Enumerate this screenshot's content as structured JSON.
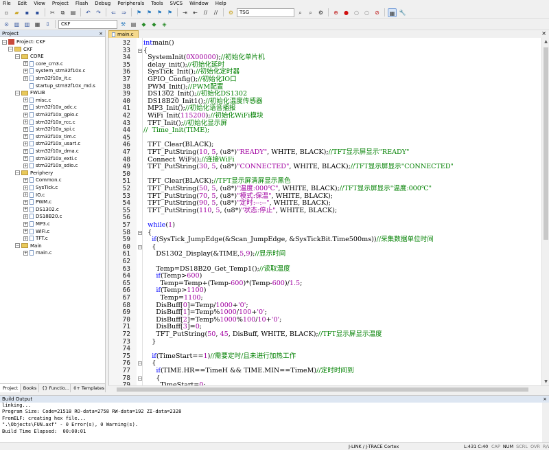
{
  "menu": [
    "File",
    "Edit",
    "View",
    "Project",
    "Flash",
    "Debug",
    "Peripherals",
    "Tools",
    "SVCS",
    "Window",
    "Help"
  ],
  "toolbar": {
    "find_combo": "TSG",
    "target_combo": "CKF"
  },
  "project_panel": {
    "title": "Project",
    "close": "×",
    "tree": [
      {
        "label": "Project: CKF",
        "type": "project",
        "level": 0,
        "pm": "-"
      },
      {
        "label": "CKF",
        "type": "folder",
        "level": 1,
        "pm": "-"
      },
      {
        "label": "CORE",
        "type": "folder",
        "level": 2,
        "pm": "-"
      },
      {
        "label": "core_cm3.c",
        "type": "file",
        "level": 3,
        "pm": "+"
      },
      {
        "label": "system_stm32f10x.c",
        "type": "file",
        "level": 3,
        "pm": "+"
      },
      {
        "label": "stm32f10x_it.c",
        "type": "file",
        "level": 3,
        "pm": "+"
      },
      {
        "label": "startup_stm32f10x_md.s",
        "type": "file",
        "level": 3,
        "pm": ""
      },
      {
        "label": "FWLIB",
        "type": "folder",
        "level": 2,
        "pm": "-"
      },
      {
        "label": "misc.c",
        "type": "file",
        "level": 3,
        "pm": "+"
      },
      {
        "label": "stm32f10x_adc.c",
        "type": "file",
        "level": 3,
        "pm": "+"
      },
      {
        "label": "stm32f10x_gpio.c",
        "type": "file",
        "level": 3,
        "pm": "+"
      },
      {
        "label": "stm32f10x_rcc.c",
        "type": "file",
        "level": 3,
        "pm": "+"
      },
      {
        "label": "stm32f10x_spi.c",
        "type": "file",
        "level": 3,
        "pm": "+"
      },
      {
        "label": "stm32f10x_tim.c",
        "type": "file",
        "level": 3,
        "pm": "+"
      },
      {
        "label": "stm32f10x_usart.c",
        "type": "file",
        "level": 3,
        "pm": "+"
      },
      {
        "label": "stm32f10x_dma.c",
        "type": "file",
        "level": 3,
        "pm": "+"
      },
      {
        "label": "stm32f10x_exti.c",
        "type": "file",
        "level": 3,
        "pm": "+"
      },
      {
        "label": "stm32f10x_sdio.c",
        "type": "file",
        "level": 3,
        "pm": "+"
      },
      {
        "label": "Periphery",
        "type": "folder",
        "level": 2,
        "pm": "-"
      },
      {
        "label": "Common.c",
        "type": "file",
        "level": 3,
        "pm": "+"
      },
      {
        "label": "SysTick.c",
        "type": "file",
        "level": 3,
        "pm": "+"
      },
      {
        "label": "IO.c",
        "type": "file",
        "level": 3,
        "pm": "+"
      },
      {
        "label": "PWM.c",
        "type": "file",
        "level": 3,
        "pm": "+"
      },
      {
        "label": "DS1302.c",
        "type": "file",
        "level": 3,
        "pm": "+"
      },
      {
        "label": "DS18B20.c",
        "type": "file",
        "level": 3,
        "pm": "+"
      },
      {
        "label": "MP3.c",
        "type": "file",
        "level": 3,
        "pm": "+"
      },
      {
        "label": "WiFi.c",
        "type": "file",
        "level": 3,
        "pm": "+"
      },
      {
        "label": "TFT.c",
        "type": "file",
        "level": 3,
        "pm": "+"
      },
      {
        "label": "Main",
        "type": "folder",
        "level": 2,
        "pm": "-"
      },
      {
        "label": "main.c",
        "type": "file",
        "level": 3,
        "pm": "+"
      }
    ],
    "tabs": [
      "Project",
      "Books",
      "{} Functio...",
      "0+ Templates"
    ]
  },
  "editor": {
    "tab_label": "main.c",
    "close": "×",
    "lines": [
      {
        "n": "32",
        "code": [
          [
            "kw",
            "int"
          ],
          [
            "",
            "main()"
          ]
        ]
      },
      {
        "n": "33",
        "fold": "-",
        "code": [
          [
            "",
            "{"
          ]
        ]
      },
      {
        "n": "34",
        "code": [
          [
            "",
            "  SystemInit("
          ],
          [
            "nm",
            "0X00000"
          ],
          [
            "",
            ");"
          ],
          [
            "cm",
            "//初始化单片机"
          ]
        ]
      },
      {
        "n": "35",
        "code": [
          [
            "",
            "  delay_init();"
          ],
          [
            "cm",
            "//初始化延时"
          ]
        ]
      },
      {
        "n": "36",
        "code": [
          [
            "",
            "  SysTick_Init();"
          ],
          [
            "cm",
            "//初始化定时器"
          ]
        ]
      },
      {
        "n": "37",
        "code": [
          [
            "",
            "  GPIO_Config();"
          ],
          [
            "cm",
            "//初始化IO口"
          ]
        ]
      },
      {
        "n": "38",
        "code": [
          [
            "",
            "  PWM_Init();"
          ],
          [
            "cm",
            "//PWM配置"
          ]
        ]
      },
      {
        "n": "39",
        "code": [
          [
            "",
            "  DS1302_Init();"
          ],
          [
            "cm",
            "//初始化DS1302"
          ]
        ]
      },
      {
        "n": "40",
        "code": [
          [
            "",
            "  DS18B20_Init1();"
          ],
          [
            "cm",
            "//初始化温度传感器"
          ]
        ]
      },
      {
        "n": "41",
        "code": [
          [
            "",
            "  MP3_Init();"
          ],
          [
            "cm",
            "//初始化语音播报"
          ]
        ]
      },
      {
        "n": "42",
        "code": [
          [
            "",
            "  WiFi_Init("
          ],
          [
            "nm",
            "115200"
          ],
          [
            "",
            ");"
          ],
          [
            "cm",
            "//初始化WiFi模块"
          ]
        ]
      },
      {
        "n": "43",
        "code": [
          [
            "",
            "  TFT_Init();"
          ],
          [
            "cm",
            "//初始化显示屏"
          ]
        ]
      },
      {
        "n": "44",
        "code": [
          [
            "cm",
            "//  Time_Init(TIME);"
          ]
        ]
      },
      {
        "n": "45",
        "code": [
          [
            "",
            ""
          ]
        ]
      },
      {
        "n": "46",
        "code": [
          [
            "",
            "  TFT_Clear(BLACK);"
          ]
        ]
      },
      {
        "n": "47",
        "code": [
          [
            "",
            "  TFT_PutString("
          ],
          [
            "nm",
            "10"
          ],
          [
            "",
            ", "
          ],
          [
            "nm",
            "5"
          ],
          [
            "",
            ", (u8*)"
          ],
          [
            "st",
            "\"READY\""
          ],
          [
            "",
            ", WHITE, BLACK);"
          ],
          [
            "cm",
            "//TFT显示屏显示\"READY\""
          ]
        ]
      },
      {
        "n": "48",
        "code": [
          [
            "",
            "  Connect_WiFi();"
          ],
          [
            "cm",
            "//连接WiFi"
          ]
        ]
      },
      {
        "n": "49",
        "code": [
          [
            "",
            "  TFT_PutString("
          ],
          [
            "nm",
            "30"
          ],
          [
            "",
            ", "
          ],
          [
            "nm",
            "5"
          ],
          [
            "",
            ", (u8*)"
          ],
          [
            "st",
            "\"CONNECTED\""
          ],
          [
            "",
            ", WHITE, BLACK);"
          ],
          [
            "cm",
            "//TFT显示屏显示\"CONNECTED\""
          ]
        ]
      },
      {
        "n": "50",
        "code": [
          [
            "",
            ""
          ]
        ]
      },
      {
        "n": "51",
        "code": [
          [
            "",
            "  TFT_Clear(BLACK);"
          ],
          [
            "cm",
            "//TFT显示屏清屏显示黑色"
          ]
        ]
      },
      {
        "n": "52",
        "code": [
          [
            "",
            "  TFT_PutString("
          ],
          [
            "nm",
            "50"
          ],
          [
            "",
            ", "
          ],
          [
            "nm",
            "5"
          ],
          [
            "",
            ", (u8*)"
          ],
          [
            "st",
            "\"温度:000℃\""
          ],
          [
            "",
            ", WHITE, BLACK);"
          ],
          [
            "cm",
            "//TFT显示屏显示\"温度:000℃\""
          ]
        ]
      },
      {
        "n": "53",
        "code": [
          [
            "",
            "  TFT_PutString("
          ],
          [
            "nm",
            "70"
          ],
          [
            "",
            ", "
          ],
          [
            "nm",
            "5"
          ],
          [
            "",
            ", (u8*)"
          ],
          [
            "st",
            "\"模式:保温\""
          ],
          [
            "",
            ", WHITE, BLACK);"
          ]
        ]
      },
      {
        "n": "54",
        "code": [
          [
            "",
            "  TFT_PutString("
          ],
          [
            "nm",
            "90"
          ],
          [
            "",
            ", "
          ],
          [
            "nm",
            "5"
          ],
          [
            "",
            ", (u8*)"
          ],
          [
            "st",
            "\"定时:--:--\""
          ],
          [
            "",
            ", WHITE, BLACK);"
          ]
        ]
      },
      {
        "n": "55",
        "code": [
          [
            "",
            "  TFT_PutString("
          ],
          [
            "nm",
            "110"
          ],
          [
            "",
            ", "
          ],
          [
            "nm",
            "5"
          ],
          [
            "",
            ", (u8*)"
          ],
          [
            "st",
            "\"状态:停止\""
          ],
          [
            "",
            ", WHITE, BLACK);"
          ]
        ]
      },
      {
        "n": "56",
        "code": [
          [
            "",
            ""
          ]
        ]
      },
      {
        "n": "57",
        "code": [
          [
            "",
            "  "
          ],
          [
            "kw",
            "while"
          ],
          [
            "",
            "("
          ],
          [
            "nm",
            "1"
          ],
          [
            "",
            ")"
          ]
        ]
      },
      {
        "n": "58",
        "fold": "-",
        "code": [
          [
            "",
            "  {"
          ]
        ]
      },
      {
        "n": "59",
        "code": [
          [
            "",
            "    "
          ],
          [
            "kw",
            "if"
          ],
          [
            "",
            "(SysTick_JumpEdge(&Scan_JumpEdge, &SysTickBit.Time500ms))"
          ],
          [
            "cm",
            "//采集数据单位时间"
          ]
        ]
      },
      {
        "n": "60",
        "fold": "-",
        "code": [
          [
            "",
            "    {"
          ]
        ]
      },
      {
        "n": "61",
        "code": [
          [
            "",
            "      DS1302_Display(&TIME,"
          ],
          [
            "nm",
            "5"
          ],
          [
            "",
            ","
          ],
          [
            "nm",
            "9"
          ],
          [
            "",
            ");"
          ],
          [
            "cm",
            "//显示时间"
          ]
        ]
      },
      {
        "n": "62",
        "code": [
          [
            "",
            ""
          ]
        ]
      },
      {
        "n": "63",
        "code": [
          [
            "",
            "      Temp=DS18B20_Get_Temp1();"
          ],
          [
            "cm",
            "//读取温度"
          ]
        ]
      },
      {
        "n": "64",
        "code": [
          [
            "",
            "      "
          ],
          [
            "kw",
            "if"
          ],
          [
            "",
            "(Temp>"
          ],
          [
            "nm",
            "600"
          ],
          [
            "",
            ")"
          ]
        ]
      },
      {
        "n": "65",
        "code": [
          [
            "",
            "        Temp=Temp+(Temp-"
          ],
          [
            "nm",
            "600"
          ],
          [
            "",
            ")*(Temp-"
          ],
          [
            "nm",
            "600"
          ],
          [
            "",
            ")/"
          ],
          [
            "nm",
            "1.5"
          ],
          [
            "",
            ";"
          ]
        ]
      },
      {
        "n": "66",
        "code": [
          [
            "",
            "      "
          ],
          [
            "kw",
            "if"
          ],
          [
            "",
            "(Temp>"
          ],
          [
            "nm",
            "1100"
          ],
          [
            "",
            ")"
          ]
        ]
      },
      {
        "n": "67",
        "code": [
          [
            "",
            "        Temp="
          ],
          [
            "nm",
            "1100"
          ],
          [
            "",
            ";"
          ]
        ]
      },
      {
        "n": "68",
        "code": [
          [
            "",
            "      DisBuff["
          ],
          [
            "nm",
            "0"
          ],
          [
            "",
            "]=Temp/"
          ],
          [
            "nm",
            "1000"
          ],
          [
            "",
            "+"
          ],
          [
            "st",
            "'0'"
          ],
          [
            "",
            ";"
          ]
        ]
      },
      {
        "n": "69",
        "code": [
          [
            "",
            "      DisBuff["
          ],
          [
            "nm",
            "1"
          ],
          [
            "",
            "]=Temp%"
          ],
          [
            "nm",
            "1000"
          ],
          [
            "",
            "/"
          ],
          [
            "nm",
            "100"
          ],
          [
            "",
            "+"
          ],
          [
            "st",
            "'0'"
          ],
          [
            "",
            ";"
          ]
        ]
      },
      {
        "n": "70",
        "code": [
          [
            "",
            "      DisBuff["
          ],
          [
            "nm",
            "2"
          ],
          [
            "",
            "]=Temp%"
          ],
          [
            "nm",
            "1000"
          ],
          [
            "",
            "%"
          ],
          [
            "nm",
            "100"
          ],
          [
            "",
            "/"
          ],
          [
            "nm",
            "10"
          ],
          [
            "",
            "+"
          ],
          [
            "st",
            "'0'"
          ],
          [
            "",
            ";"
          ]
        ]
      },
      {
        "n": "71",
        "code": [
          [
            "",
            "      DisBuff["
          ],
          [
            "nm",
            "3"
          ],
          [
            "",
            "]="
          ],
          [
            "nm",
            "0"
          ],
          [
            "",
            ";"
          ]
        ]
      },
      {
        "n": "72",
        "code": [
          [
            "",
            "      TFT_PutString("
          ],
          [
            "nm",
            "50"
          ],
          [
            "",
            ", "
          ],
          [
            "nm",
            "45"
          ],
          [
            "",
            ", DisBuff, WHITE, BLACK);"
          ],
          [
            "cm",
            "//TFT显示屏显示温度"
          ]
        ]
      },
      {
        "n": "73",
        "code": [
          [
            "",
            "    }"
          ]
        ]
      },
      {
        "n": "74",
        "code": [
          [
            "",
            ""
          ]
        ]
      },
      {
        "n": "75",
        "code": [
          [
            "",
            "    "
          ],
          [
            "kw",
            "if"
          ],
          [
            "",
            "(TimeStart=="
          ],
          [
            "nm",
            "1"
          ],
          [
            "",
            ")"
          ],
          [
            "cm",
            "//需要定时/且未进行加热工作"
          ]
        ]
      },
      {
        "n": "76",
        "fold": "-",
        "code": [
          [
            "",
            "    {"
          ]
        ]
      },
      {
        "n": "77",
        "code": [
          [
            "",
            "      "
          ],
          [
            "kw",
            "if"
          ],
          [
            "",
            "(TIME.HR==TimeH && TIME.MIN==TimeM)"
          ],
          [
            "cm",
            "//定时时间到"
          ]
        ]
      },
      {
        "n": "78",
        "fold": "-",
        "code": [
          [
            "",
            "      {"
          ]
        ]
      },
      {
        "n": "79",
        "code": [
          [
            "",
            "        TimeStart="
          ],
          [
            "nm",
            "0"
          ],
          [
            "",
            ";"
          ]
        ]
      }
    ]
  },
  "build_output": {
    "title": "Build Output",
    "close": "×",
    "lines": [
      "linking...",
      "Program Size: Code=21518 RO-data=2758 RW-data=192 ZI-data=2328",
      "FromELF: creating hex file...",
      "\".\\Objects\\FUN.axf\" - 0 Error(s), 0 Warning(s).",
      "Build Time Elapsed:  00:00:01"
    ]
  },
  "status_bar": {
    "debugger": "J-LINK / J-TRACE Cortex",
    "position": "L:431 C:40",
    "indicators": [
      "CAP",
      "NUM",
      "SCRL",
      "OVR",
      "R/W"
    ]
  },
  "colors": {
    "keyword": "#0000ff",
    "comment": "#008000",
    "string": "#a000a0",
    "tab_active": "#f5d98c",
    "panel_header": "#dde6f2"
  }
}
